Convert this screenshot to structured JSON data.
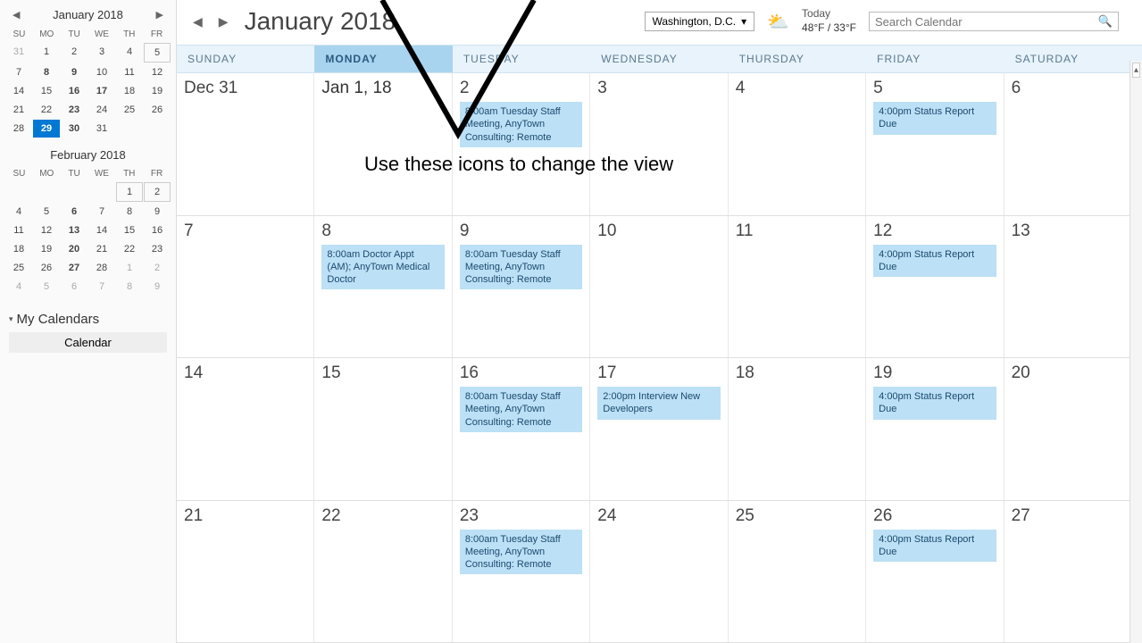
{
  "sidebar": {
    "jan": {
      "title": "January 2018",
      "dow": [
        "SU",
        "MO",
        "TU",
        "WE",
        "TH",
        "FR"
      ],
      "rows": [
        [
          {
            "n": "31",
            "dim": true
          },
          {
            "n": "1"
          },
          {
            "n": "2"
          },
          {
            "n": "3"
          },
          {
            "n": "4"
          },
          {
            "n": "5",
            "box": true
          }
        ],
        [
          {
            "n": "7"
          },
          {
            "n": "8",
            "bold": true
          },
          {
            "n": "9",
            "bold": true
          },
          {
            "n": "10"
          },
          {
            "n": "11"
          },
          {
            "n": "12"
          }
        ],
        [
          {
            "n": "14"
          },
          {
            "n": "15"
          },
          {
            "n": "16",
            "bold": true
          },
          {
            "n": "17",
            "bold": true
          },
          {
            "n": "18"
          },
          {
            "n": "19"
          }
        ],
        [
          {
            "n": "21"
          },
          {
            "n": "22"
          },
          {
            "n": "23",
            "bold": true
          },
          {
            "n": "24"
          },
          {
            "n": "25"
          },
          {
            "n": "26"
          }
        ],
        [
          {
            "n": "28"
          },
          {
            "n": "29",
            "today": true
          },
          {
            "n": "30",
            "bold": true
          },
          {
            "n": "31"
          },
          {
            "n": ""
          },
          {
            "n": ""
          }
        ]
      ]
    },
    "feb": {
      "title": "February 2018",
      "dow": [
        "SU",
        "MO",
        "TU",
        "WE",
        "TH",
        "FR"
      ],
      "rows": [
        [
          {
            "n": ""
          },
          {
            "n": ""
          },
          {
            "n": ""
          },
          {
            "n": ""
          },
          {
            "n": "1",
            "box": true
          },
          {
            "n": "2",
            "box": true
          }
        ],
        [
          {
            "n": "4"
          },
          {
            "n": "5"
          },
          {
            "n": "6",
            "bold": true
          },
          {
            "n": "7"
          },
          {
            "n": "8"
          },
          {
            "n": "9"
          }
        ],
        [
          {
            "n": "11"
          },
          {
            "n": "12"
          },
          {
            "n": "13",
            "bold": true
          },
          {
            "n": "14"
          },
          {
            "n": "15"
          },
          {
            "n": "16"
          }
        ],
        [
          {
            "n": "18"
          },
          {
            "n": "19"
          },
          {
            "n": "20",
            "bold": true
          },
          {
            "n": "21"
          },
          {
            "n": "22"
          },
          {
            "n": "23"
          }
        ],
        [
          {
            "n": "25"
          },
          {
            "n": "26"
          },
          {
            "n": "27",
            "bold": true
          },
          {
            "n": "28"
          },
          {
            "n": "1",
            "dim": true
          },
          {
            "n": "2",
            "dim": true
          }
        ],
        [
          {
            "n": "4",
            "dim": true
          },
          {
            "n": "5",
            "dim": true
          },
          {
            "n": "6",
            "dim": true
          },
          {
            "n": "7",
            "dim": true
          },
          {
            "n": "8",
            "dim": true
          },
          {
            "n": "9",
            "dim": true
          }
        ]
      ]
    },
    "mycals_label": "My Calendars",
    "cal_item": "Calendar"
  },
  "header": {
    "title": "January 2018",
    "location": "Washington, D.C.",
    "today_label": "Today",
    "today_temp": "48°F / 33°F",
    "search_placeholder": "Search Calendar"
  },
  "dow": [
    "SUNDAY",
    "MONDAY",
    "TUESDAY",
    "WEDNESDAY",
    "THURSDAY",
    "FRIDAY",
    "SATURDAY"
  ],
  "dow_selected": 1,
  "weeks": [
    {
      "days": [
        {
          "num": "Dec 31"
        },
        {
          "num": "Jan 1, 18",
          "sel": true
        },
        {
          "num": "2",
          "events": [
            "8:00am Tuesday Staff Meeting, AnyTown Consulting: Remote"
          ]
        },
        {
          "num": "3"
        },
        {
          "num": "4"
        },
        {
          "num": "5",
          "events": [
            "4:00pm Status Report Due"
          ]
        },
        {
          "num": "6"
        }
      ]
    },
    {
      "days": [
        {
          "num": "7"
        },
        {
          "num": "8",
          "events": [
            "8:00am Doctor Appt (AM); AnyTown Medical Doctor"
          ]
        },
        {
          "num": "9",
          "events": [
            "8:00am Tuesday Staff Meeting, AnyTown Consulting: Remote"
          ]
        },
        {
          "num": "10"
        },
        {
          "num": "11"
        },
        {
          "num": "12",
          "events": [
            "4:00pm Status Report Due"
          ]
        },
        {
          "num": "13"
        }
      ]
    },
    {
      "days": [
        {
          "num": "14"
        },
        {
          "num": "15"
        },
        {
          "num": "16",
          "events": [
            "8:00am Tuesday Staff Meeting, AnyTown Consulting: Remote"
          ]
        },
        {
          "num": "17",
          "events": [
            "2:00pm Interview New Developers"
          ]
        },
        {
          "num": "18"
        },
        {
          "num": "19",
          "events": [
            "4:00pm Status Report Due"
          ]
        },
        {
          "num": "20"
        }
      ]
    },
    {
      "days": [
        {
          "num": "21"
        },
        {
          "num": "22"
        },
        {
          "num": "23",
          "events": [
            "8:00am Tuesday Staff Meeting, AnyTown Consulting: Remote"
          ]
        },
        {
          "num": "24"
        },
        {
          "num": "25"
        },
        {
          "num": "26",
          "events": [
            "4:00pm Status Report Due"
          ]
        },
        {
          "num": "27"
        }
      ]
    }
  ],
  "annotation": "Use these icons to change the view"
}
